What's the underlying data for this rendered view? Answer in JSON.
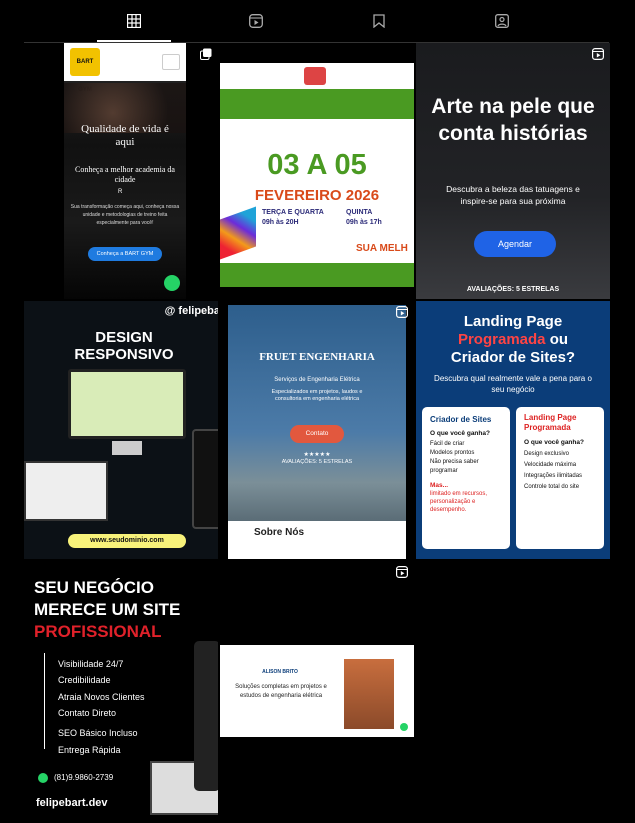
{
  "tabs": [
    {
      "name": "grid-icon",
      "active": true
    },
    {
      "name": "reels-icon",
      "active": false
    },
    {
      "name": "saved-icon",
      "active": false
    },
    {
      "name": "tagged-icon",
      "active": false
    }
  ],
  "posts": {
    "gym": {
      "logo_text": "BART GYM",
      "headline": "Qualidade de vida é aqui",
      "subheadline": "Conheça a melhor academia da cidade",
      "location": "R",
      "body": "Sua transformação começa aqui, conheça nossa unidade e metodologias de treino feita especialmente para você!",
      "cta": "Conheça a BART GYM"
    },
    "event": {
      "dates": "03 A 05",
      "month": "FEVEREIRO 2026",
      "day1": "TERÇA E QUARTA",
      "time1": "09h às 20H",
      "day2": "QUINTA",
      "time2": "09h às 17h",
      "footer": "SUA MELH"
    },
    "tattoo": {
      "headline": "Arte na pele que conta histórias",
      "body": "Descubra a beleza das tatuagens e inspire-se para sua próxima",
      "cta": "Agendar",
      "rating": "AVALIAÇÕES: 5 ESTRELAS"
    },
    "design": {
      "handle": "@ felipeba",
      "headline1": "DESIGN",
      "headline2": "RESPONSIVO",
      "url": "www.seudominio.com"
    },
    "fruet": {
      "title": "FRUET ENGENHARIA",
      "subtitle": "Serviços de Engenharia Elétrica",
      "body": "Especializados em projetos, laudos e consultoria em engenharia elétrica",
      "cta": "Contato",
      "stars": "★★★★★",
      "rating": "AVALIAÇÕES: 5 ESTRELAS",
      "section": "Sobre Nós"
    },
    "landing": {
      "h1a": "Landing Page",
      "h1b": "Programada",
      "h1c": "ou",
      "h1d": "Criador de Sites?",
      "sub": "Descubra qual realmente vale a pena para o seu negócio",
      "col1_title": "Criador de Sites",
      "col1_q": "O que você ganha?",
      "col1_items": [
        "Fácil de criar",
        "Modelos prontos",
        "Não precisa saber programar"
      ],
      "col1_cons_title": "Mas...",
      "col1_cons": "limitado em recursos, personalização e desempenho.",
      "col2_title": "Landing Page Programada",
      "col2_q": "O que você ganha?",
      "col2_items": [
        "Design exclusivo",
        "Velocidade máxima",
        "Integrações ilimitadas",
        "Controle total do site"
      ]
    },
    "business": {
      "h1": "SEU NEGÓCIO",
      "h2": "MERECE UM SITE",
      "h3": "PROFISSIONAL",
      "items": [
        "Visibilidade 24/7",
        "Credibilidade",
        "Atraia Novos Clientes",
        "Contato Direto",
        "SEO Básico Incluso",
        "Entrega Rápida"
      ],
      "phone": "(81)9.9860-2739",
      "brand": "felipebart.dev"
    },
    "alison": {
      "logo": "ALISON BRITO",
      "text": "Soluções completas em projetos e estudos de engenharia elétrica"
    }
  },
  "colors": {
    "accent_blue": "#0b3d79",
    "red": "#e0212a",
    "green": "#4a9a22",
    "tattoo_button": "#1f63e6"
  }
}
